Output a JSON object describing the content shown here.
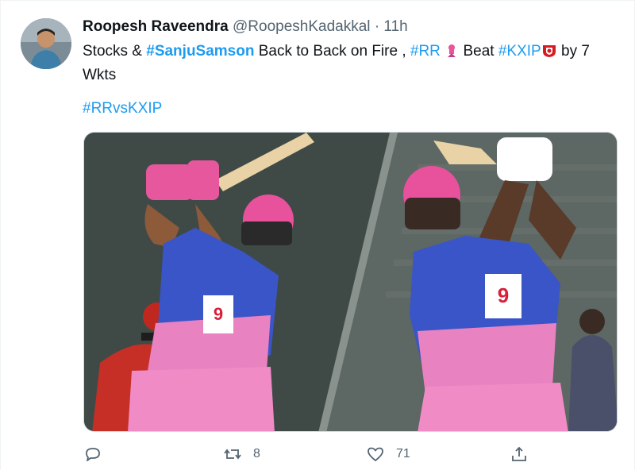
{
  "tweet": {
    "display_name": "Roopesh Raveendra",
    "handle": "@RoopeshKadakkal",
    "separator": "·",
    "time": "11h",
    "text": {
      "part1": "Stocks & ",
      "tag_sanju": "#SanjuSamson",
      "part2": " Back to Back on Fire , ",
      "tag_rr": "#RR",
      "part3": " Beat ",
      "tag_kxip": "#KXIP",
      "part4": " by 7 Wkts"
    },
    "tag_line": "#RRvsKXIP",
    "media_description_icon": "cricket-photo",
    "actions": {
      "reply_count": "",
      "retweet_count": "8",
      "like_count": "71"
    }
  },
  "colors": {
    "link": "#1d9bf0",
    "muted": "#536471",
    "text": "#0f1419",
    "jersey_blue": "#3a55c8",
    "jersey_pink": "#e882c0"
  }
}
